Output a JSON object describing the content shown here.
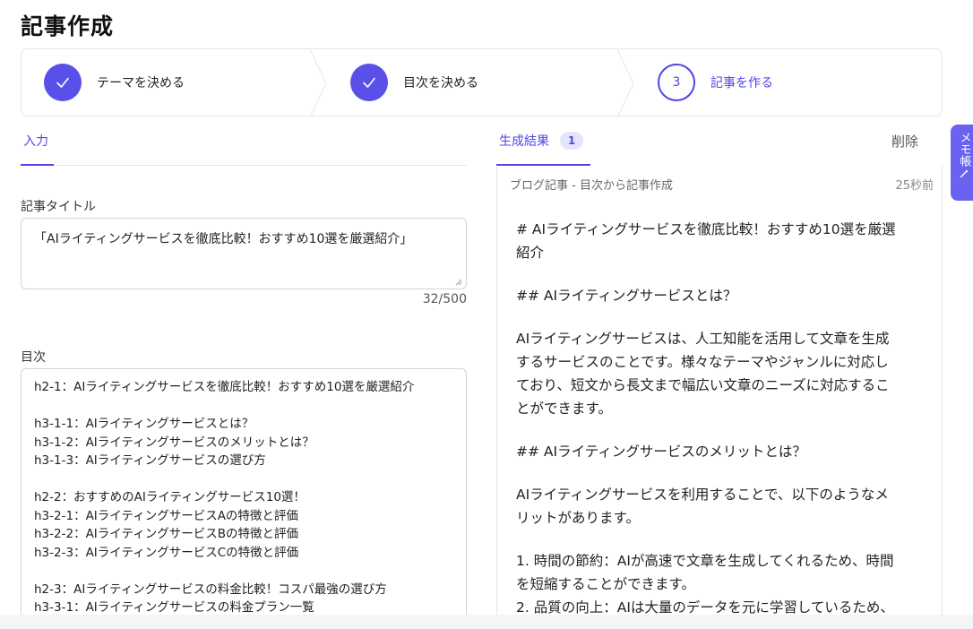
{
  "page": {
    "title": "記事作成"
  },
  "stepper": {
    "steps": [
      {
        "number": "",
        "label": "テーマを決める",
        "state": "done"
      },
      {
        "number": "",
        "label": "目次を決める",
        "state": "done"
      },
      {
        "number": "3",
        "label": "記事を作る",
        "state": "active"
      }
    ]
  },
  "left": {
    "tab_label": "入力",
    "title_field": {
      "label": "記事タイトル",
      "value": "「AIライティングサービスを徹底比較！おすすめ10選を厳選紹介」",
      "counter": "32/500"
    },
    "toc_field": {
      "label": "目次",
      "lines": [
        "h2-1：AIライティングサービスを徹底比較！おすすめ10選を厳選紹介",
        "",
        "h3-1-1：AIライティングサービスとは？",
        "h3-1-2：AIライティングサービスのメリットとは？",
        "h3-1-3：AIライティングサービスの選び方",
        "",
        "h2-2：おすすめのAIライティングサービス10選！",
        "h3-2-1：AIライティングサービスAの特徴と評価",
        "h3-2-2：AIライティングサービスBの特徴と評価",
        "h3-2-3：AIライティングサービスCの特徴と評価",
        "",
        "h2-3：AIライティングサービスの料金比較！コスパ最強の選び方",
        "h3-3-1：AIライティングサービスの料金プラン一覧"
      ]
    }
  },
  "right": {
    "tab_label": "生成結果",
    "badge": "1",
    "delete_label": "削除",
    "result": {
      "header": "ブログ記事 - 目次から記事作成",
      "time": "25秒前",
      "paragraphs": [
        [
          "# AIライティングサービスを徹底比較！おすすめ10選を厳選",
          "紹介"
        ],
        [
          "## AIライティングサービスとは？"
        ],
        [
          "AIライティングサービスは、人工知能を活用して文章を生成",
          "するサービスのことです。様々なテーマやジャンルに対応し",
          "ており、短文から長文まで幅広い文章のニーズに対応するこ",
          "とができます。"
        ],
        [
          "## AIライティングサービスのメリットとは？"
        ],
        [
          "AIライティングサービスを利用することで、以下のようなメ",
          "リットがあります。"
        ],
        [
          "1. 時間の節約：AIが高速で文章を生成してくれるため、時間",
          "を短縮することができます。",
          "2. 品質の向上：AIは大量のデータを元に学習しているため、"
        ]
      ]
    }
  },
  "memo": {
    "label": "メモ帳"
  },
  "colors": {
    "accent": "#4f46e5",
    "accent_fill": "#5850e8"
  }
}
